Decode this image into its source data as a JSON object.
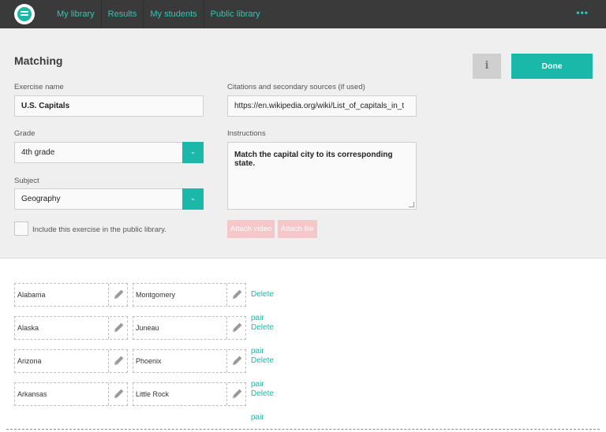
{
  "nav": {
    "items": [
      {
        "label": "My library"
      },
      {
        "label": "Results"
      },
      {
        "label": "My students"
      },
      {
        "label": "Public library"
      }
    ],
    "more_icon": "ellipsis-icon",
    "more_label": "•••"
  },
  "form": {
    "title": "Matching",
    "exercise_name_label": "Exercise name",
    "exercise_name_value": "U.S. Capitals",
    "grade_label": "Grade",
    "grade_value": "4th grade",
    "subject_label": "Subject",
    "subject_value": "Geography",
    "public_library_label": "Include this exercise in the public library.",
    "citations_label": "Citations and secondary sources (if used)",
    "citations_value": "https://en.wikipedia.org/wiki/List_of_capitals_in_t",
    "instructions_label": "Instructions",
    "instructions_value": "Match the capital city to its corresponding state.",
    "attach_video_label": "Attach video",
    "attach_file_label": "Attach file",
    "info_label": "i",
    "done_label": "Done"
  },
  "pairs": [
    {
      "left": "Alabama",
      "right": "Montgomery",
      "delete_label": "Delete pair"
    },
    {
      "left": "Alaska",
      "right": "Juneau",
      "delete_label": "Delete pair"
    },
    {
      "left": "Arizona",
      "right": "Phoenix",
      "delete_label": "Delete pair"
    },
    {
      "left": "Arkansas",
      "right": "Little Rock",
      "delete_label": "Delete pair"
    }
  ],
  "colors": {
    "accent": "#1ab8a8",
    "nav_link": "#27c9b7",
    "topbar": "#3a3a3a",
    "attach_disabled": "#f6c7c9"
  }
}
